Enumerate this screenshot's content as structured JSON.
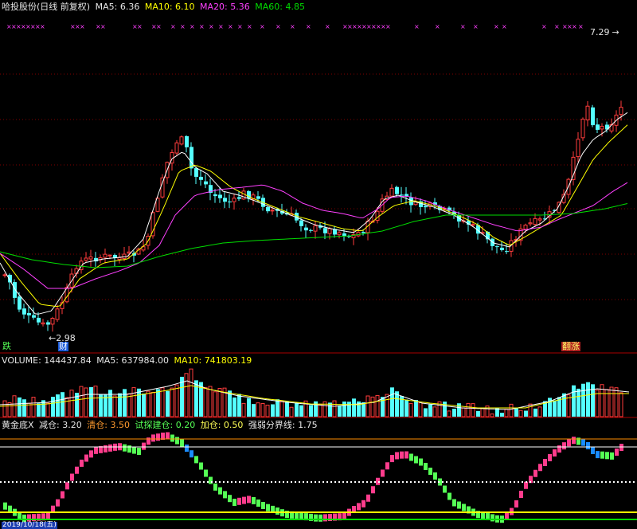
{
  "header": {
    "title": "哈投股份(日线 前复权)",
    "ma5_label": "MA5:",
    "ma5_value": "6.36",
    "ma10_label": "MA10:",
    "ma10_value": "6.10",
    "ma20_label": "MA20:",
    "ma20_value": "5.36",
    "ma60_label": "MA60:",
    "ma60_value": "4.85"
  },
  "price_panel": {
    "high_marker": "7.29",
    "low_marker": "2.98",
    "signal_left": "跌",
    "signal_cai": "财",
    "signal_right": "翻涨"
  },
  "volume_panel": {
    "volume_label": "VOLUME:",
    "volume_value": "144437.84",
    "ma5_label": "MA5:",
    "ma5_value": "637984.00",
    "ma10_label": "MA10:",
    "ma10_value": "741803.19"
  },
  "indicator_panel": {
    "name": "黄金底X",
    "reduce_label": "减仓:",
    "reduce_value": "3.20",
    "clear_label": "清仓:",
    "clear_value": "3.50",
    "trial_label": "试探建仓:",
    "trial_value": "0.20",
    "add_label": "加仓:",
    "add_value": "0.50",
    "boundary_label": "强弱分界线:",
    "boundary_value": "1.75",
    "date_stub": "2019/10/18(五)"
  },
  "colors": {
    "up": "#ff3d3d",
    "down": "#54ffff",
    "ma5": "#ffffff",
    "ma10": "#ffff00",
    "ma20": "#ff40ff",
    "ma60": "#00dd00",
    "grid": "#800000",
    "signal_pink": "#ff3c8c",
    "signal_green": "#55ff55",
    "signal_blue": "#1a8cff"
  }
}
